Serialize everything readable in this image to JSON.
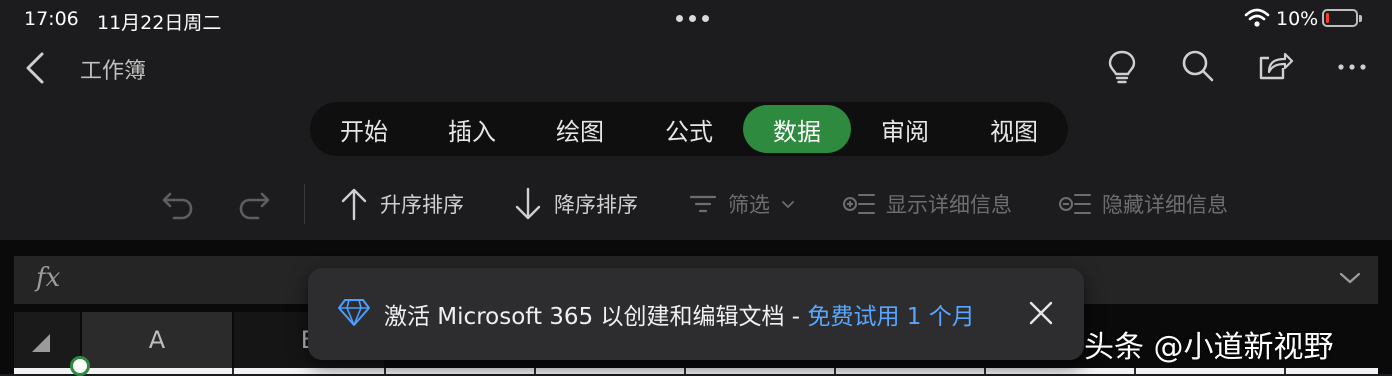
{
  "status_bar": {
    "time": "17:06",
    "date": "11月22日周二",
    "battery_percent": "10%",
    "battery_level": 0.1,
    "battery_color": "#ff3b30"
  },
  "nav": {
    "title": "工作簿",
    "icons": [
      "back-chevron-icon",
      "lightbulb-icon",
      "search-icon",
      "share-icon",
      "more-icon"
    ]
  },
  "tabs": [
    {
      "label": "开始",
      "active": false
    },
    {
      "label": "插入",
      "active": false
    },
    {
      "label": "绘图",
      "active": false
    },
    {
      "label": "公式",
      "active": false
    },
    {
      "label": "数据",
      "active": true
    },
    {
      "label": "审阅",
      "active": false
    },
    {
      "label": "视图",
      "active": false
    }
  ],
  "toolbar": {
    "sort_asc": "升序排序",
    "sort_desc": "降序排序",
    "filter": "筛选",
    "show_details": "显示详细信息",
    "hide_details": "隐藏详细信息"
  },
  "formula_bar": {
    "fx_label": "fx"
  },
  "sheet": {
    "columns": [
      "A",
      "B"
    ]
  },
  "toast": {
    "message": "激活 Microsoft 365 以创建和编辑文档 - ",
    "link": "免费试用 1 个月"
  },
  "watermark": "头条 @小道新视野",
  "colors": {
    "accent_green": "#2e8a3e",
    "link_blue": "#58a6ff",
    "background": "#1c1c1e"
  }
}
